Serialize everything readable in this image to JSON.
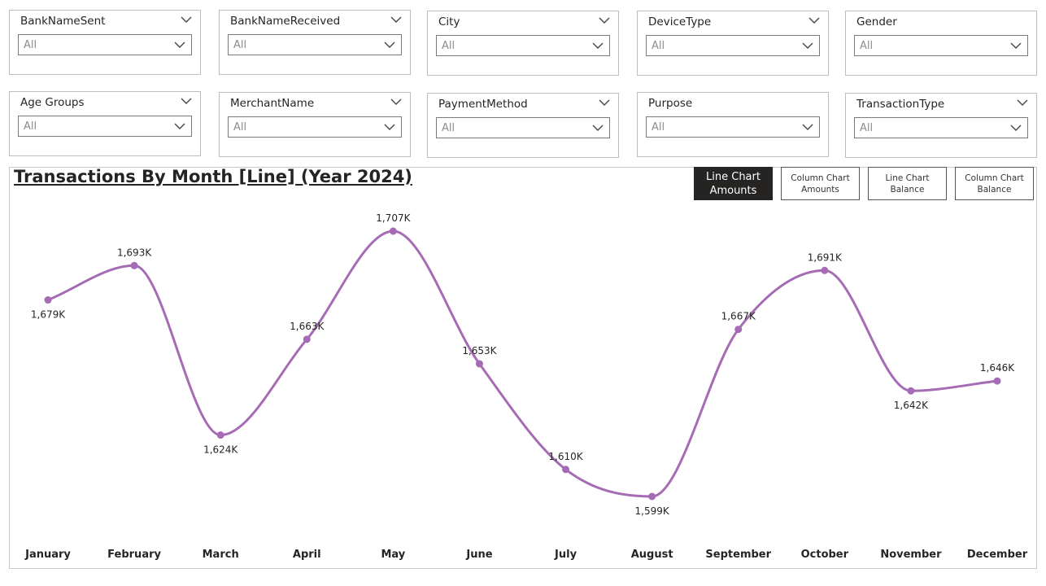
{
  "slicers": [
    {
      "header": "BankNameSent",
      "value": "All"
    },
    {
      "header": "BankNameReceived",
      "value": "All"
    },
    {
      "header": "City",
      "value": "All"
    },
    {
      "header": "DeviceType",
      "value": "All"
    },
    {
      "header": "Gender",
      "value": "All"
    },
    {
      "header": "Age Groups",
      "value": "All"
    },
    {
      "header": "MerchantName",
      "value": "All"
    },
    {
      "header": "PaymentMethod",
      "value": "All"
    },
    {
      "header": "Purpose",
      "value": "All"
    },
    {
      "header": "TransactionType",
      "value": "All"
    }
  ],
  "toggle_buttons": [
    {
      "label": "Line Chart Amounts",
      "active": true
    },
    {
      "label": "Column Chart Amounts",
      "active": false
    },
    {
      "label": "Line Chart Balance",
      "active": false
    },
    {
      "label": "Column Chart Balance",
      "active": false
    }
  ],
  "chart_data": {
    "type": "line",
    "title": "Transactions By Month [Line] (Year 2024)",
    "categories": [
      "January",
      "February",
      "March",
      "April",
      "May",
      "June",
      "July",
      "August",
      "September",
      "October",
      "November",
      "December"
    ],
    "values": [
      1679,
      1693,
      1624,
      1663,
      1707,
      1653,
      1610,
      1599,
      1667,
      1691,
      1642,
      1646
    ],
    "data_labels": [
      "1,679K",
      "1,693K",
      "1,624K",
      "1,663K",
      "1,707K",
      "1,653K",
      "1,610K",
      "1,599K",
      "1,667K",
      "1,691K",
      "1,642K",
      "1,646K"
    ],
    "unit": "K",
    "line_color": "#a66bb5",
    "grid": false,
    "legend": "none",
    "y_axis_visible": false
  },
  "colors": {
    "active_button_bg": "#252423",
    "border": "#bdbdbd"
  }
}
